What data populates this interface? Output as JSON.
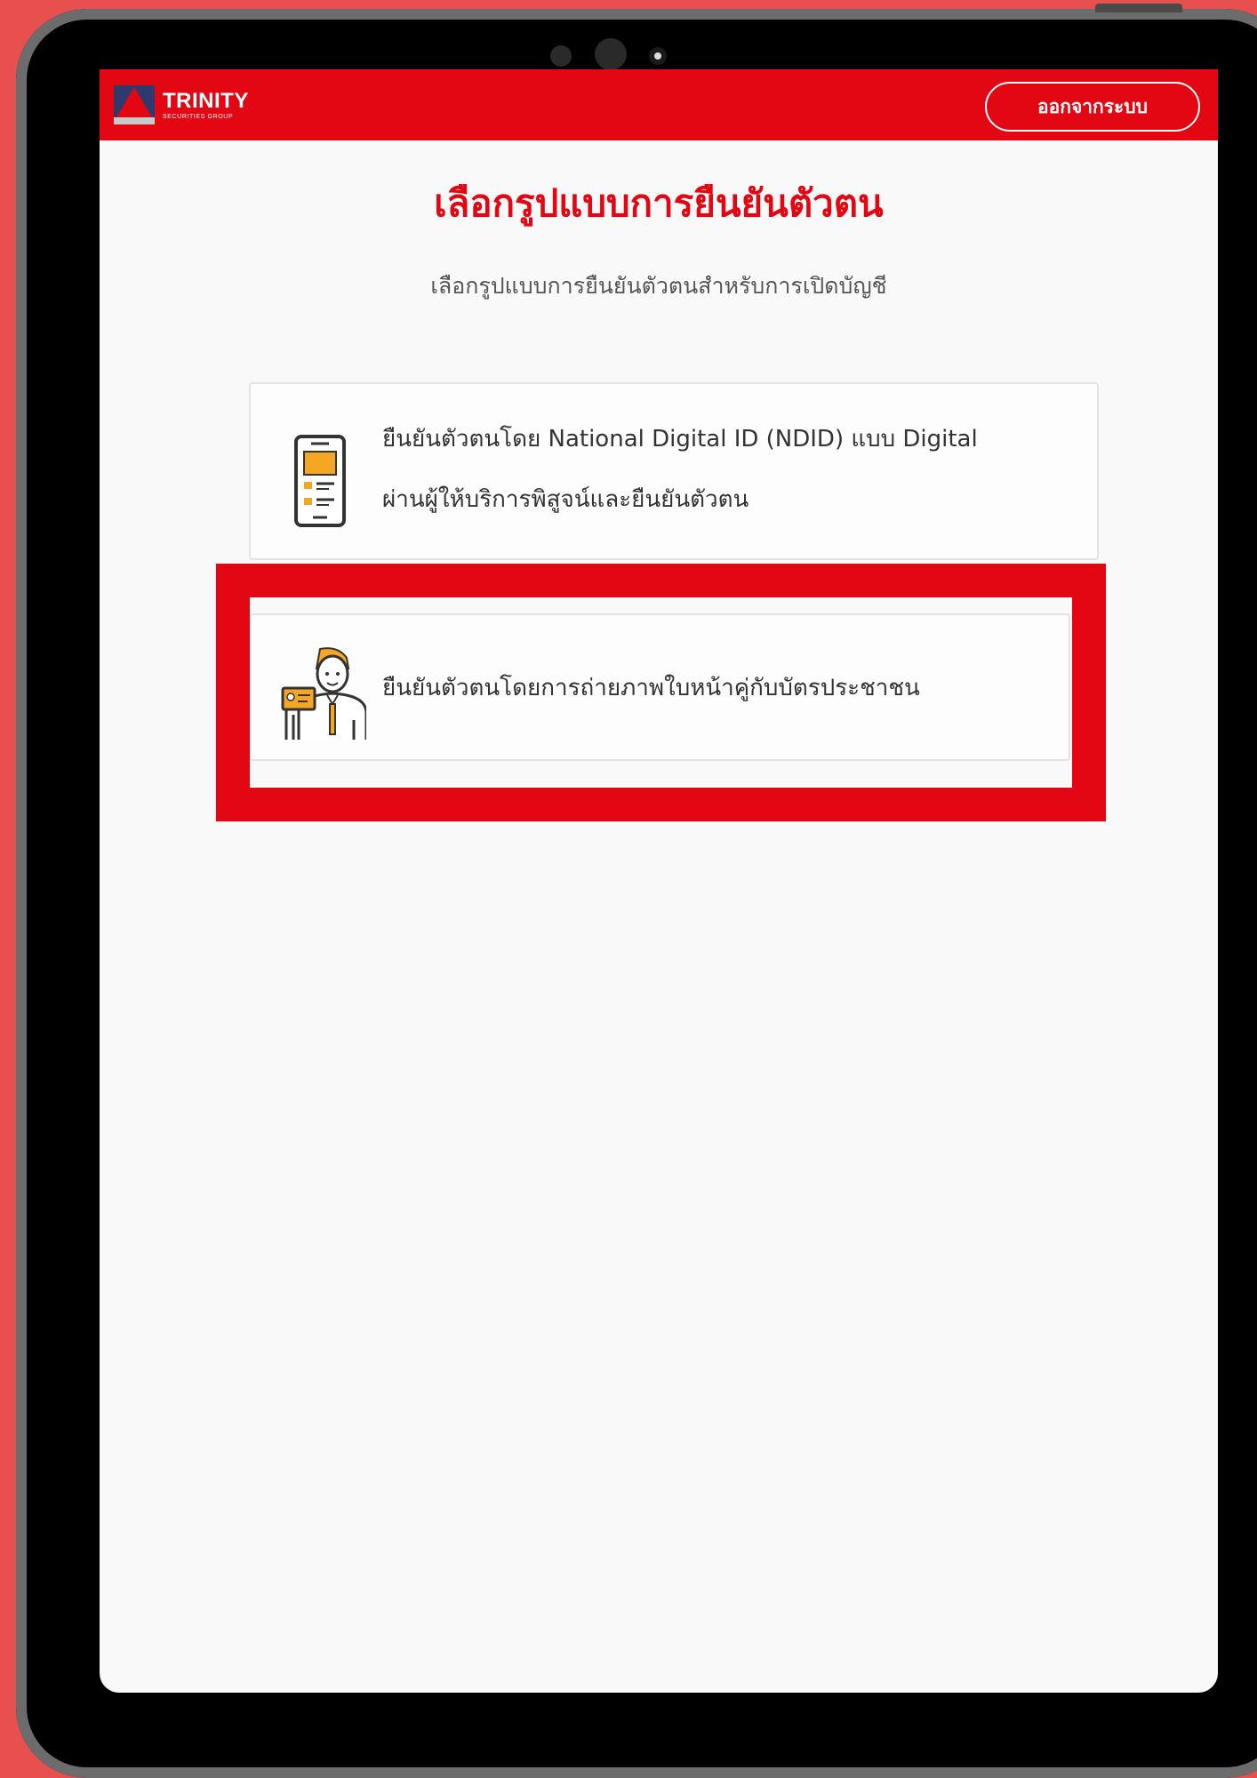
{
  "header": {
    "logo": {
      "name": "TRINITY",
      "tagline": "SECURITIES GROUP"
    },
    "logout_label": "ออกจากระบบ"
  },
  "page": {
    "title": "เลือกรูปแบบการยืนยันตัวตน",
    "subtitle": "เลือกรูปแบบการยืนยันตัวตนสำหรับการเปิดบัญชี"
  },
  "options": [
    {
      "icon": "smartphone-document-icon",
      "line1": "ยืนยันตัวตนโดย National Digital ID (NDID) แบบ Digital",
      "line2": "ผ่านผู้ให้บริการพิสูจน์และยืนยันตัวตน"
    },
    {
      "icon": "person-with-id-card-icon",
      "line1": "ยืนยันตัวตนโดยการถ่ายภาพใบหน้าคู่กับบัตรประชาชน",
      "highlighted": true
    }
  ],
  "colors": {
    "brand_red": "#e30613",
    "background": "#e85050",
    "device_frame": "#000000",
    "accent_orange": "#f5a623"
  }
}
